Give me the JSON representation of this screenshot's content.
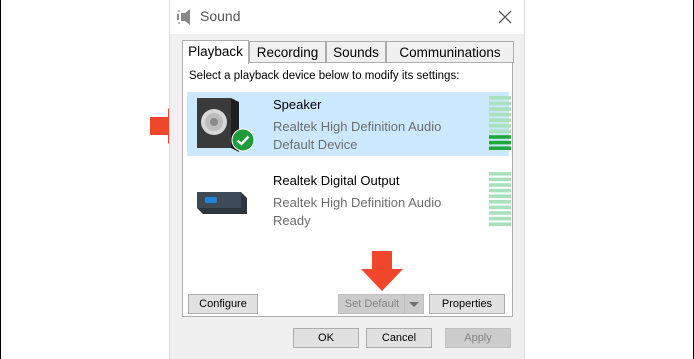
{
  "window": {
    "title": "Sound"
  },
  "tabs": [
    {
      "label": "Playback",
      "active": true
    },
    {
      "label": "Recording",
      "active": false
    },
    {
      "label": "Sounds",
      "active": false
    },
    {
      "label": "Communinations",
      "active": false
    }
  ],
  "panel": {
    "instruction": "Select a playback device below to modify its settings:"
  },
  "devices": [
    {
      "name": "Speaker",
      "driver": "Realtek High Definition Audio",
      "status": "Default Device",
      "selected": true,
      "icon": "speaker-icon",
      "badge": "default-check-icon",
      "level": 0.25
    },
    {
      "name": "Realtek Digital Output",
      "driver": "Realtek High Definition Audio",
      "status": "Ready",
      "selected": false,
      "icon": "digital-output-icon",
      "level": 0
    }
  ],
  "panel_buttons": {
    "configure": "Configure",
    "set_default": "Set Default",
    "properties": "Properties"
  },
  "dialog_buttons": {
    "ok": "OK",
    "cancel": "Cancel",
    "apply": "Apply"
  },
  "colors": {
    "selection": "#cce8ff",
    "meter_active": "#1ea83c",
    "meter_idle": "#a9e1bd",
    "arrow": "#f0472c",
    "check_badge": "#1e9b3a"
  }
}
